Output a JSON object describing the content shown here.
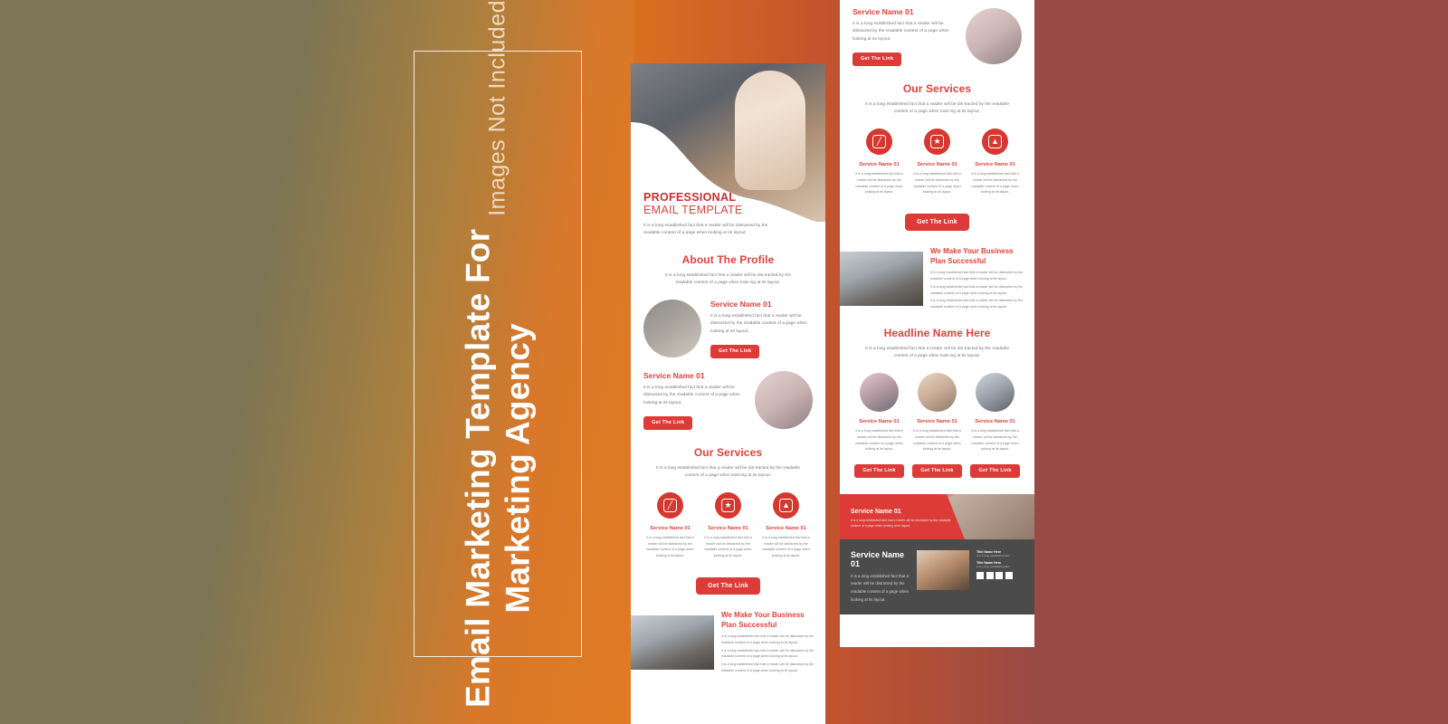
{
  "poster": {
    "title_line1": "Email Marketing Template For",
    "title_line2": "Marketing Agency",
    "subtitle": "Images Not Included",
    "colors": {
      "bg_left": "#7d7553",
      "bg_right": "#9a4a44",
      "accent_orange": "#d9701f",
      "accent_red": "#dd3b38",
      "heading_red": "#e0423c",
      "footer_dark": "#4b4b4b"
    }
  },
  "lorem": {
    "short": "It is a long established fact that a reader will be distracted by the readable content of a page when looking at its layout.",
    "centered": "It is a long established fact that a reader will be dis-tracted by the readable content of a page when look-ing at its layout.",
    "tiny": "It is a long established fact that a reader will be distracted by the readable content of a page when looking at its layout."
  },
  "template_left": {
    "hero": {
      "kicker": "PROFESSIONAL",
      "kicker2": "EMAIL TEMPLATE",
      "paragraph": "It is a long established fact that a reader will be distracted by the readable content of a page when looking at its layout."
    },
    "about": {
      "heading": "About The Profile",
      "paragraph": "It is a long established fact that a reader will be dis-tracted by the readable content of a page when look-ing at its layout."
    },
    "service_card_1": {
      "title": "Service Name 01",
      "paragraph": "It is a long established fact that a reader will be distracted by the readable content of a page when looking at its layout.",
      "button": "Get The Link"
    },
    "service_card_2": {
      "title": "Service Name 01",
      "paragraph": "It is a long established fact that a reader will be distracted by the readable content of a page when looking at its layout.",
      "button": "Get The Link"
    },
    "our_services": {
      "heading": "Our Services",
      "paragraph": "It is a long established fact that a reader will be dis-tracted by the readable content of a page when look-ing at its layout.",
      "items": [
        {
          "icon": "pen-icon",
          "glyph": "╱",
          "title": "Service Name 01",
          "paragraph": "It is a long established fact that a reader will be distracted by the readable content of a page when looking at its layout."
        },
        {
          "icon": "star-badge-icon",
          "glyph": "★",
          "title": "Service Name 01",
          "paragraph": "It is a long established fact that a reader will be distracted by the readable content of a page when looking at its layout."
        },
        {
          "icon": "chart-icon",
          "glyph": "▲",
          "title": "Service Name 01",
          "paragraph": "It is a long established fact that a reader will be distracted by the readable content of a page when looking at its layout."
        }
      ],
      "button": "Get The Link"
    },
    "business": {
      "title": "We Make Your Business Plan Successful",
      "paragraph1": "It is a long established fact that a reader will be distracted by the readable content of a page when looking at its layout.",
      "paragraph2": "It is a long established fact that a reader will be distracted by the readable content of a page when looking at its layout.",
      "paragraph3": "It is a long established fact that a reader will be distracted by the readable content of a page when looking at its layout."
    }
  },
  "template_right": {
    "service_card_top": {
      "title": "Service Name 01",
      "paragraph": "It is a long established fact that a reader will be distracted by the readable content of a page when looking at its layout.",
      "button": "Get The Link"
    },
    "our_services": {
      "heading": "Our Services",
      "paragraph": "It is a long established fact that a reader will be dis-tracted by the readable content of a page when look-ing at its layout.",
      "items": [
        {
          "icon": "pen-icon",
          "glyph": "╱",
          "title": "Service Name 01",
          "paragraph": "It is a long established fact that a reader will be distracted by the readable content of a page when looking at its layout."
        },
        {
          "icon": "star-badge-icon",
          "glyph": "★",
          "title": "Service Name 01",
          "paragraph": "It is a long established fact that a reader will be distracted by the readable content of a page when looking at its layout."
        },
        {
          "icon": "chart-icon",
          "glyph": "▲",
          "title": "Service Name 01",
          "paragraph": "It is a long established fact that a reader will be distracted by the readable content of a page when looking at its layout."
        }
      ],
      "button": "Get The Link"
    },
    "business": {
      "title": "We Make Your Business Plan Successful",
      "paragraph1": "It is a long established fact that a reader will be distracted by the readable content of a page when looking at its layout.",
      "paragraph2": "It is a long established fact that a reader will be distracted by the readable content of a page when looking at its layout.",
      "paragraph3": "It is a long established fact that a reader will be distracted by the readable content of a page when looking at its layout."
    },
    "headline": {
      "heading": "Headline Name Here",
      "paragraph": "It is a long established fact that a reader will be dis-tracted by the readable content of a page when look-ing at its layout.",
      "cards": [
        {
          "title": "Service Name 01",
          "paragraph": "It is a long established fact that a reader will be distracted by the readable content of a page when looking at its layout.",
          "button": "Get The Link"
        },
        {
          "title": "Service Name 01",
          "paragraph": "It is a long established fact that a reader will be distracted by the readable content of a page when looking at its layout.",
          "button": "Get The Link"
        },
        {
          "title": "Service Name 01",
          "paragraph": "It is a long established fact that a reader will be distracted by the readable content of a page when looking at its layout.",
          "button": "Get The Link"
        }
      ]
    },
    "banner": {
      "title": "Service Name 01",
      "paragraph": "It is a long established fact that a reader will be distracted by the readable content of a page when looking at its layout."
    },
    "footer": {
      "title": "Service Name 01",
      "paragraph": "It is a long established fact that a reader will be distracted by the readable content of a page when looking at its layout.",
      "links": [
        {
          "title": "Title Name Here",
          "sub": "It is a long established fact"
        },
        {
          "title": "Title Name Here",
          "sub": "It is a long established fact"
        }
      ],
      "social_icons": [
        "facebook-icon",
        "twitter-icon",
        "instagram-icon",
        "linkedin-icon"
      ]
    }
  }
}
